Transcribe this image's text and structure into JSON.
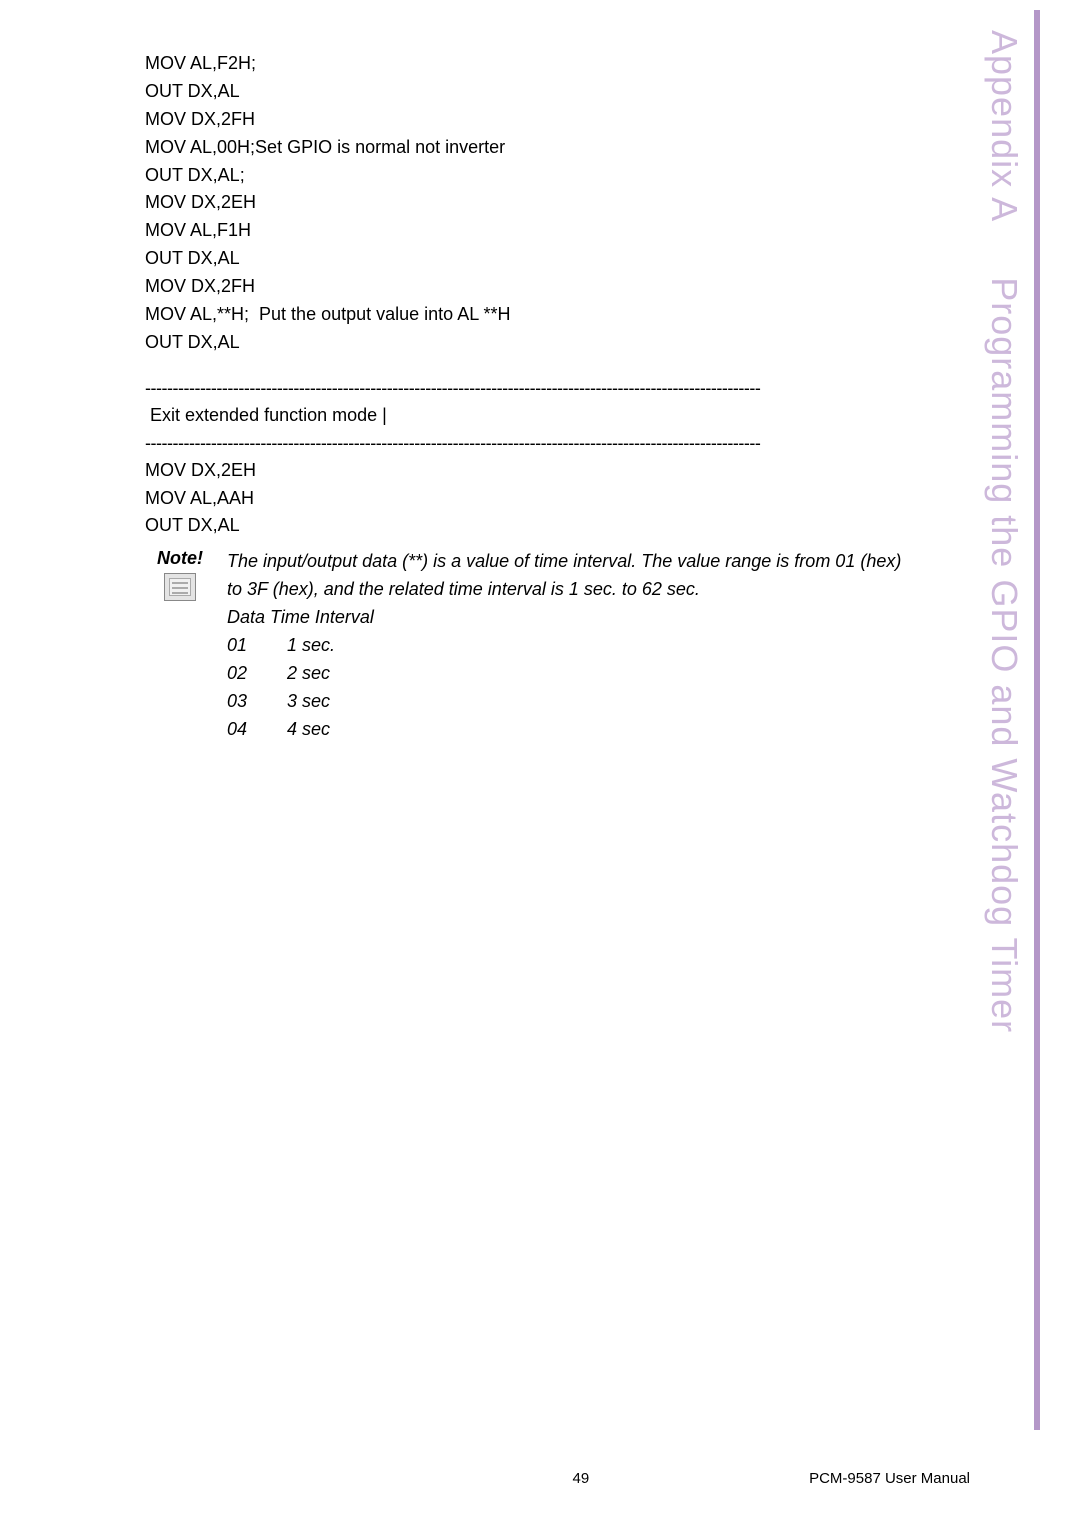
{
  "sidebar": {
    "title_prefix": "Appendix A",
    "title_suffix": "Programming the GPIO and Watchdog Timer"
  },
  "code_block_1": "MOV AL,F2H;\nOUT DX,AL\nMOV DX,2FH\nMOV AL,00H;Set GPIO is normal not inverter\nOUT DX,AL;\nMOV DX,2EH\nMOV AL,F1H\nOUT DX,AL\nMOV DX,2FH\nMOV AL,**H;  Put the output value into AL **H\nOUT DX,AL",
  "divider_dashes": "----------------------------------------------------------------------------------------------------------------",
  "exit_mode_label": " Exit extended function mode |",
  "code_block_2": "MOV DX,2EH\nMOV AL,AAH\nOUT DX,AL",
  "note": {
    "label": "Note!",
    "text_line_1": "The input/output data (**) is a value of time interval. The value range is from 01 (hex) to 3F (hex), and the related time interval is 1 sec. to 62 sec.",
    "data_time_interval_label": "Data Time Interval",
    "intervals": [
      {
        "key": "01",
        "value": "1 sec."
      },
      {
        "key": "02",
        "value": "2 sec"
      },
      {
        "key": "03",
        "value": "3 sec"
      },
      {
        "key": "04",
        "value": "4 sec"
      }
    ]
  },
  "footer": {
    "page_number": "49",
    "manual_name": "PCM-9587 User Manual"
  }
}
